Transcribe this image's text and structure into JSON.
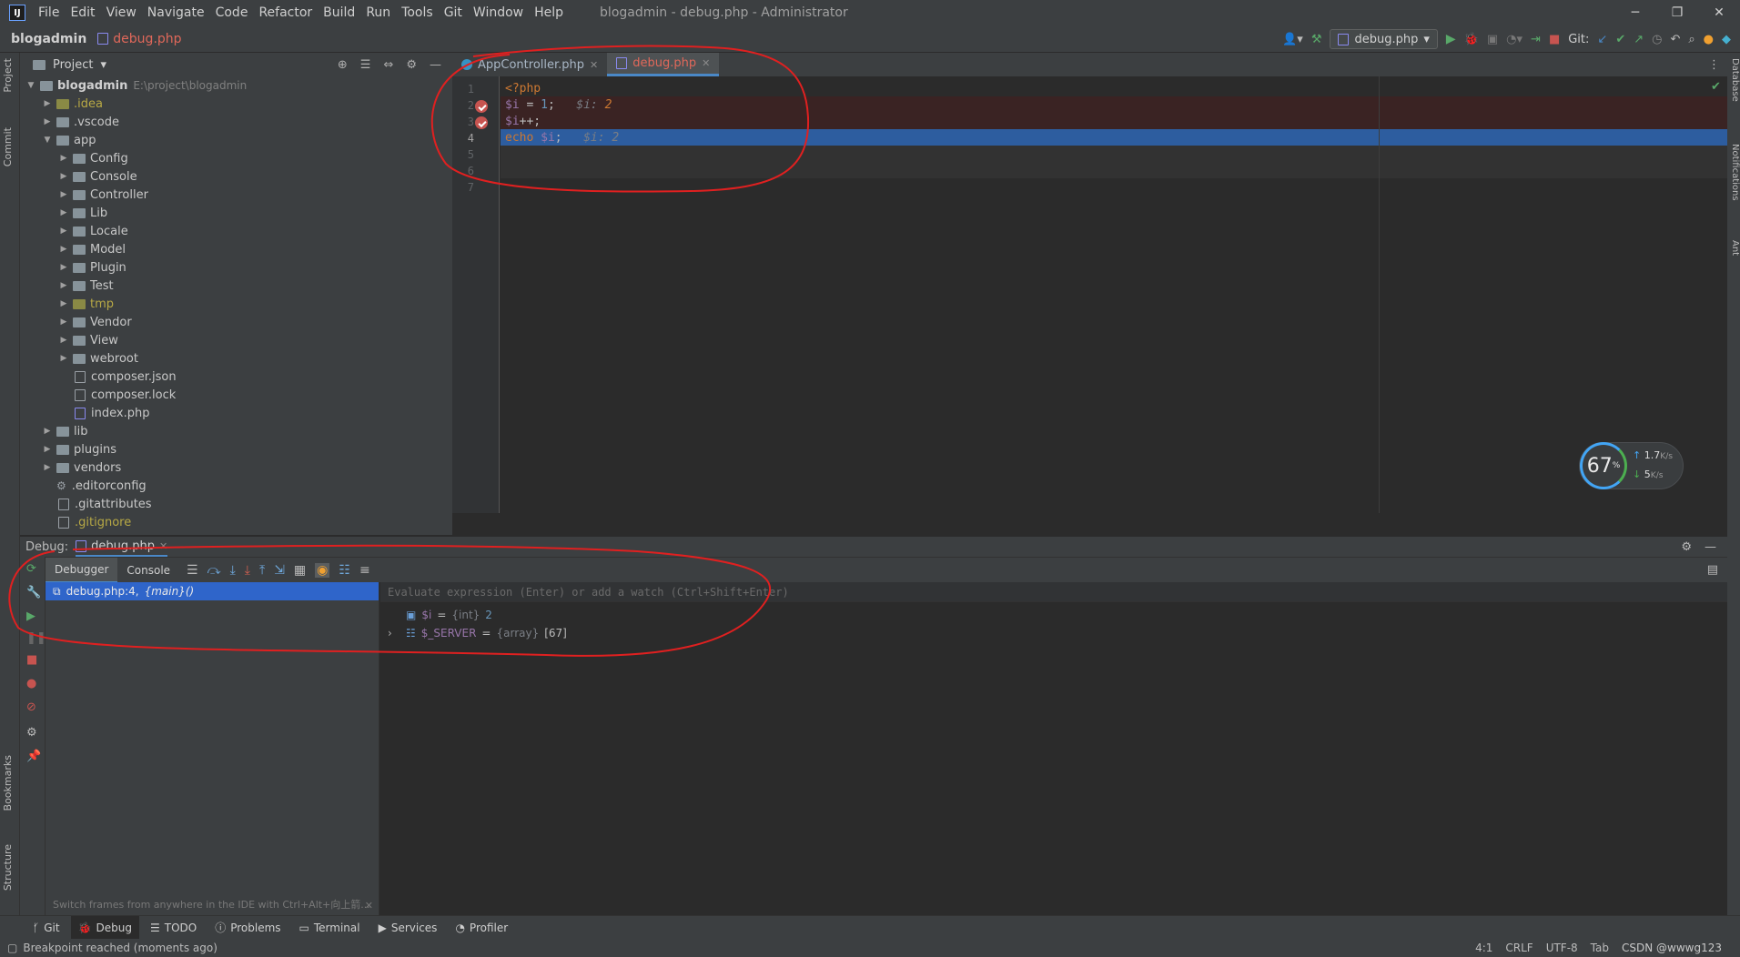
{
  "window": {
    "title": "blogadmin - debug.php - Administrator",
    "menu": [
      "File",
      "Edit",
      "View",
      "Navigate",
      "Code",
      "Refactor",
      "Build",
      "Run",
      "Tools",
      "Git",
      "Window",
      "Help"
    ]
  },
  "navbar": {
    "project": "blogadmin",
    "file": "debug.php",
    "run_config": "debug.php",
    "git_label": "Git:"
  },
  "left_stripe": {
    "project": "Project",
    "commit": "Commit",
    "bookmarks": "Bookmarks",
    "structure": "Structure"
  },
  "right_stripe": {
    "database": "Database",
    "notifications": "Notifications",
    "ant": "Ant"
  },
  "project_panel": {
    "title": "Project",
    "root": {
      "name": "blogadmin",
      "path": "E:\\project\\blogadmin"
    },
    "items": [
      {
        "label": ".idea",
        "kind": "folder-yellow",
        "depth": 1,
        "expanded": false
      },
      {
        "label": ".vscode",
        "kind": "folder",
        "depth": 1,
        "expanded": false
      },
      {
        "label": "app",
        "kind": "folder",
        "depth": 1,
        "expanded": true
      },
      {
        "label": "Config",
        "kind": "folder",
        "depth": 2,
        "expanded": false
      },
      {
        "label": "Console",
        "kind": "folder",
        "depth": 2,
        "expanded": false
      },
      {
        "label": "Controller",
        "kind": "folder",
        "depth": 2,
        "expanded": false
      },
      {
        "label": "Lib",
        "kind": "folder",
        "depth": 2,
        "expanded": false
      },
      {
        "label": "Locale",
        "kind": "folder",
        "depth": 2,
        "expanded": false
      },
      {
        "label": "Model",
        "kind": "folder",
        "depth": 2,
        "expanded": false
      },
      {
        "label": "Plugin",
        "kind": "folder",
        "depth": 2,
        "expanded": false
      },
      {
        "label": "Test",
        "kind": "folder",
        "depth": 2,
        "expanded": false
      },
      {
        "label": "tmp",
        "kind": "folder-yellow",
        "depth": 2,
        "expanded": false
      },
      {
        "label": "Vendor",
        "kind": "folder",
        "depth": 2,
        "expanded": false
      },
      {
        "label": "View",
        "kind": "folder",
        "depth": 2,
        "expanded": false
      },
      {
        "label": "webroot",
        "kind": "folder",
        "depth": 2,
        "expanded": false
      },
      {
        "label": "composer.json",
        "kind": "file",
        "depth": 2
      },
      {
        "label": "composer.lock",
        "kind": "file",
        "depth": 2
      },
      {
        "label": "index.php",
        "kind": "php",
        "depth": 2
      },
      {
        "label": "lib",
        "kind": "folder",
        "depth": 1,
        "expanded": false
      },
      {
        "label": "plugins",
        "kind": "folder",
        "depth": 1,
        "expanded": false
      },
      {
        "label": "vendors",
        "kind": "folder",
        "depth": 1,
        "expanded": false
      },
      {
        "label": ".editorconfig",
        "kind": "config",
        "depth": 1
      },
      {
        "label": ".gitattributes",
        "kind": "file",
        "depth": 1
      },
      {
        "label": ".gitignore",
        "kind": "file-yellow",
        "depth": 1
      }
    ]
  },
  "editor": {
    "tabs": [
      {
        "label": "AppController.php",
        "active": false
      },
      {
        "label": "debug.php",
        "active": true
      }
    ],
    "line_numbers": [
      "1",
      "2",
      "3",
      "4",
      "5",
      "6",
      "7"
    ],
    "lines": [
      {
        "code": [
          {
            "t": "<?php",
            "c": "kw"
          }
        ]
      },
      {
        "code": [
          {
            "t": "$i",
            "c": "var"
          },
          {
            "t": " = ",
            "c": ""
          },
          {
            "t": "1",
            "c": "num"
          },
          {
            "t": ";   ",
            "c": ""
          },
          {
            "t": "$i: ",
            "c": "inl"
          },
          {
            "t": "2",
            "c": "inlv"
          }
        ],
        "breakpoint": true
      },
      {
        "code": [
          {
            "t": "$i",
            "c": "var"
          },
          {
            "t": "++;",
            "c": ""
          }
        ],
        "breakpoint": true
      },
      {
        "code": [
          {
            "t": "echo ",
            "c": "kw"
          },
          {
            "t": "$i",
            "c": "var"
          },
          {
            "t": ";   ",
            "c": ""
          },
          {
            "t": "$i: 2",
            "c": "inl"
          }
        ],
        "current": true
      },
      {
        "code": []
      },
      {
        "code": []
      },
      {
        "code": []
      }
    ]
  },
  "speed_widget": {
    "percent": "67",
    "unit": "%",
    "up": "1.7",
    "up_unit": "K/s",
    "down": "5",
    "down_unit": "K/s"
  },
  "debug": {
    "label": "Debug:",
    "session": "debug.php",
    "subtabs": [
      "Debugger",
      "Console"
    ],
    "frame": {
      "location": "debug.php:4,",
      "func": "{main}()"
    },
    "tip": "Switch frames from anywhere in the IDE with Ctrl+Alt+向上箭...",
    "eval_placeholder": "Evaluate expression (Enter) or add a watch (Ctrl+Shift+Enter)",
    "variables": [
      {
        "name": "$i",
        "type": "{int}",
        "value": "2",
        "expandable": false
      },
      {
        "name": "$_SERVER",
        "type": "{array}",
        "value": "[67]",
        "expandable": true
      }
    ]
  },
  "bottom_tabs": [
    "Git",
    "Debug",
    "TODO",
    "Problems",
    "Terminal",
    "Services",
    "Profiler"
  ],
  "status": {
    "message": "Breakpoint reached (moments ago)",
    "position": "4:1",
    "line_sep": "CRLF",
    "encoding": "UTF-8",
    "indent": "Tab",
    "watermark": "CSDN @wwwg123"
  }
}
